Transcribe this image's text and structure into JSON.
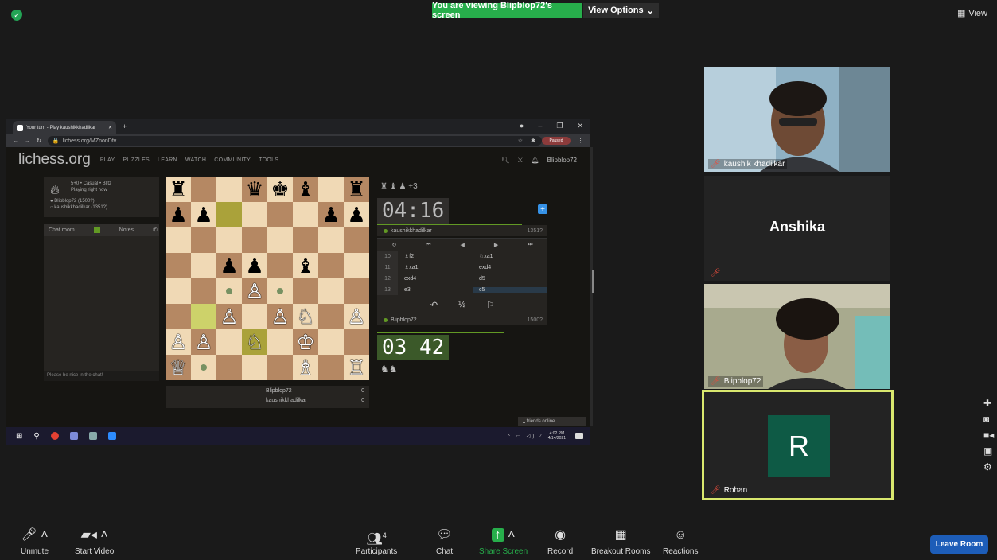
{
  "top": {
    "viewing_banner": "You are viewing Blipblop72's screen",
    "view_options": "View Options",
    "view_button": "View"
  },
  "browser": {
    "tab_title": "Your turn - Play kaushikkhadilkar",
    "url": "lichess.org/MZnonDfv",
    "paused": "Paused"
  },
  "lichess": {
    "logo": "lichess.org",
    "menu": [
      "PLAY",
      "PUZZLES",
      "LEARN",
      "WATCH",
      "COMMUNITY",
      "TOOLS"
    ],
    "username": "Blipblop72",
    "game_type": "5+0 • Casual • Blitz",
    "game_status": "Playing right now",
    "player_white": "Blipblop72 (1500?)",
    "player_black": "kaushikkhadilkar (1351?)",
    "chat_tab": "Chat room",
    "notes_tab": "Notes",
    "chat_placeholder": "Please be nice in the chat!",
    "captured": "♜ ♝ ♟ +3",
    "clock_top": "04:16",
    "clock_bottom": "03 42",
    "top_player": "kaushikkhadilkar",
    "top_rating": "1351?",
    "bottom_player": "Blipblop72",
    "bottom_rating": "1500?",
    "moves": [
      {
        "n": "10",
        "w": "♗f2",
        "b": "♘xa1"
      },
      {
        "n": "11",
        "w": "♗xa1",
        "b": "exd4"
      },
      {
        "n": "12",
        "w": "exd4",
        "b": "d5"
      },
      {
        "n": "13",
        "w": "e3",
        "b": "c5"
      }
    ],
    "scores": [
      {
        "name": "Blipblop72",
        "score": "0"
      },
      {
        "name": "kaushikkhadilkar",
        "score": "0"
      }
    ],
    "friends_online": "friends online"
  },
  "taskbar": {
    "time": "4:02 PM",
    "date": "4/14/2021"
  },
  "participants": [
    {
      "name": "kaushik khadilkar"
    },
    {
      "name": "Anshika"
    },
    {
      "name": "Blipblop72"
    },
    {
      "name": "Rohan",
      "initial": "R"
    }
  ],
  "toolbar": {
    "unmute": "Unmute",
    "start_video": "Start Video",
    "participants": "Participants",
    "participants_count": "4",
    "chat": "Chat",
    "share_screen": "Share Screen",
    "record": "Record",
    "breakout": "Breakout Rooms",
    "reactions": "Reactions",
    "leave": "Leave Room"
  }
}
